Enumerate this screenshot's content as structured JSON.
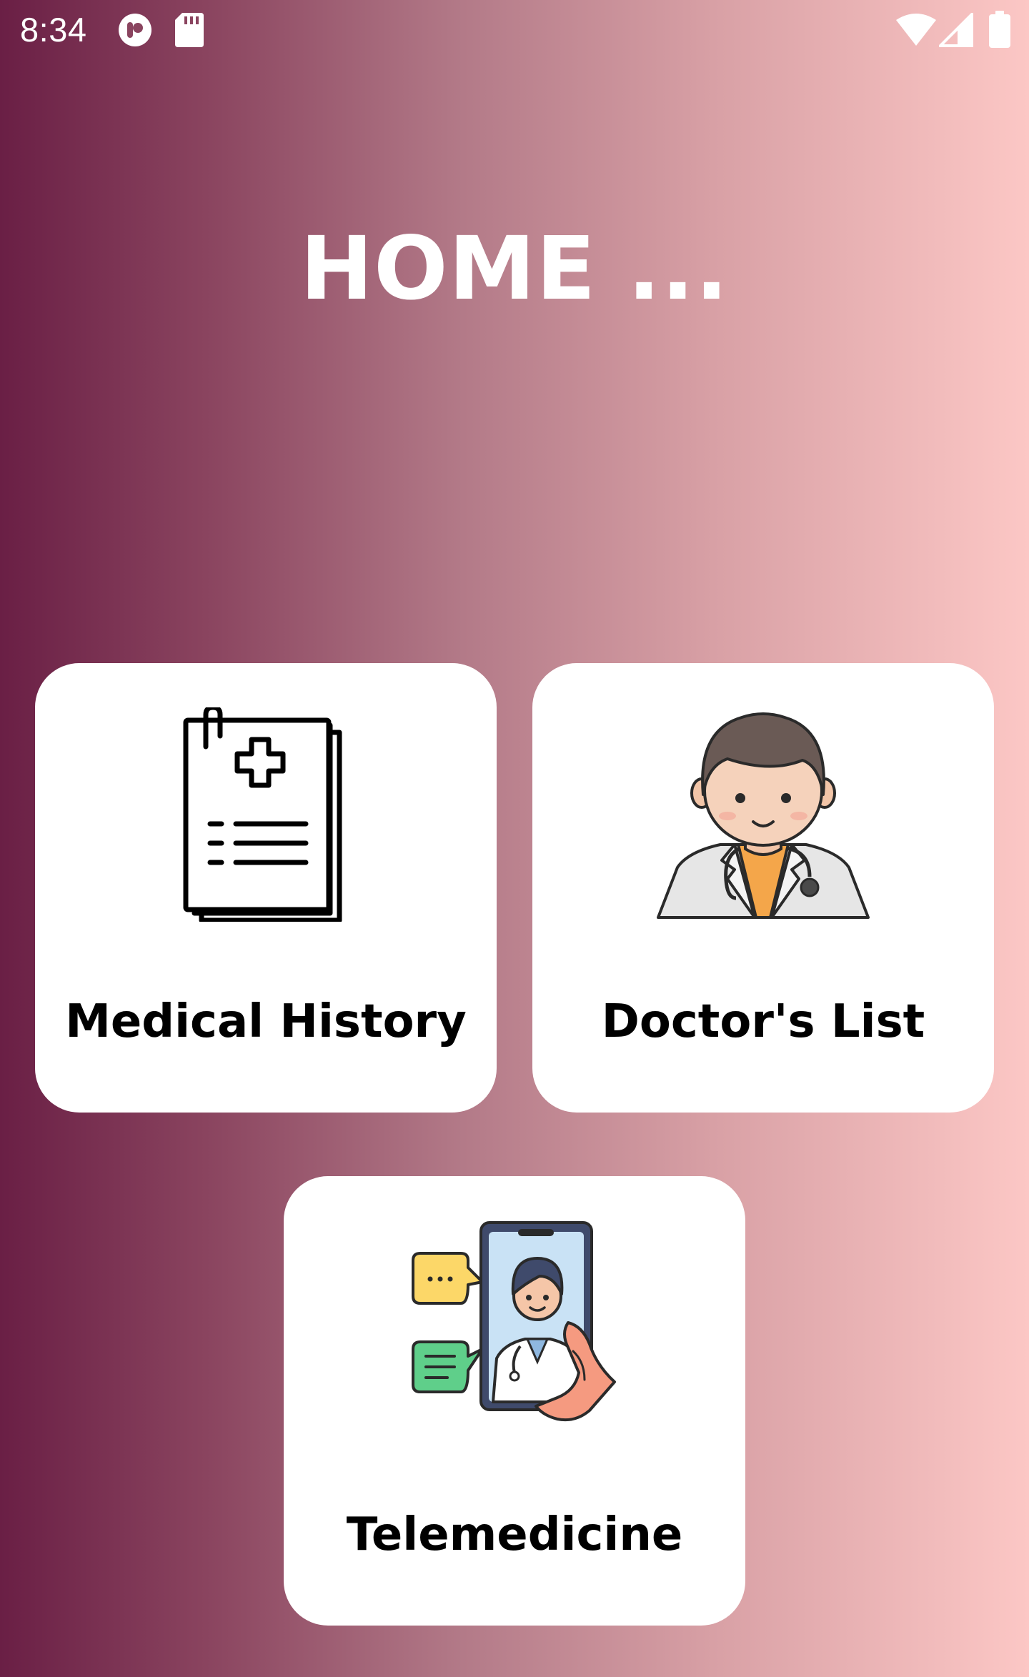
{
  "status_bar": {
    "time": "8:34",
    "icons": [
      "media-app-icon",
      "sd-card-icon",
      "wifi-icon",
      "cell-signal-icon",
      "battery-icon"
    ]
  },
  "page": {
    "title": "HOME ..."
  },
  "cards": [
    {
      "label": "Medical History",
      "icon": "medical-record-icon"
    },
    {
      "label": "Doctor's List",
      "icon": "doctor-icon"
    },
    {
      "label": "Telemedicine",
      "icon": "telemedicine-icon"
    }
  ],
  "colors": {
    "gradient_start": "#6a1f45",
    "gradient_end": "#fcc7c5",
    "card_background": "#ffffff",
    "title_text": "#ffffff",
    "label_text": "#000000"
  }
}
